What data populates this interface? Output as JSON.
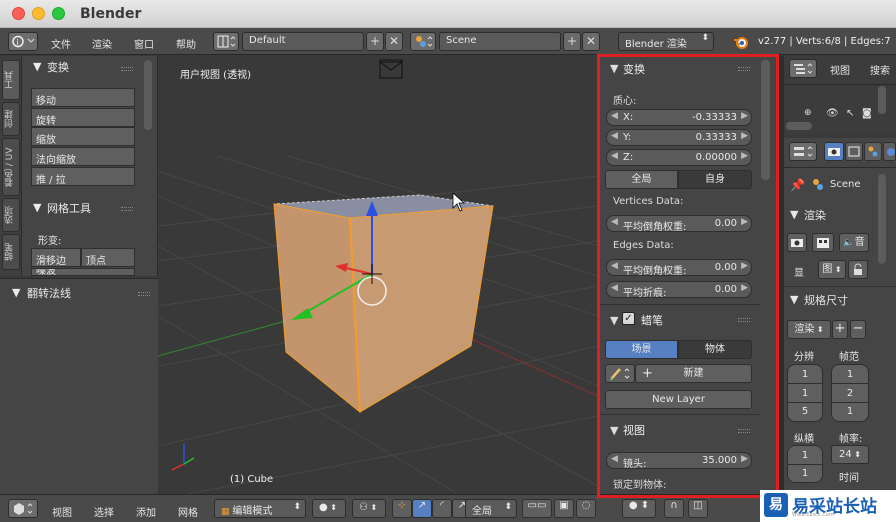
{
  "window": {
    "title": "Blender"
  },
  "info_header": {
    "menus": [
      "文件",
      "渲染",
      "窗口",
      "帮助"
    ],
    "layout_name": "Default",
    "scene_name": "Scene",
    "render_engine": "Blender 渲染",
    "stats": "v2.77 | Verts:6/8 | Edges:7"
  },
  "tool_tabs": [
    "工具",
    "创建",
    "着色 / UV",
    "选项",
    "蜡笔"
  ],
  "tool_shelf": {
    "transform_title": "变换",
    "transform_buttons": [
      "移动",
      "旋转",
      "缩放",
      "法向缩放",
      "推 / 拉"
    ],
    "mesh_tools_title": "网格工具",
    "deform_label": "形变:",
    "deform_buttons": [
      "滑移边",
      "顶点"
    ],
    "deform_partial": "噪波"
  },
  "operator_panel": {
    "title": "翻转法线"
  },
  "viewport": {
    "view_label": "用户视图 (透视)",
    "object_label": "(1) Cube"
  },
  "properties_panel": {
    "transform_title": "变换",
    "median_label": "质心:",
    "x": {
      "label": "X:",
      "value": "-0.33333"
    },
    "y": {
      "label": "Y:",
      "value": "0.33333"
    },
    "z": {
      "label": "Z:",
      "value": "0.00000"
    },
    "space_global": "全局",
    "space_local": "自身",
    "vertices_data_label": "Vertices Data:",
    "vertex_bevel": {
      "label": "平均倒角权重:",
      "value": "0.00"
    },
    "edges_data_label": "Edges Data:",
    "edge_bevel": {
      "label": "平均倒角权重:",
      "value": "0.00"
    },
    "edge_crease": {
      "label": "平均折痕:",
      "value": "0.00"
    },
    "grease_title": "蜡笔",
    "grease_scene": "场景",
    "grease_object": "物体",
    "grease_new": "新建",
    "new_layer": "New Layer",
    "view_title": "视图",
    "lens": {
      "label": "镜头:",
      "value": "35.000"
    },
    "lock_to_object": "锁定到物体:"
  },
  "outliner": {
    "view_menu": "视图",
    "search_menu": "搜索"
  },
  "render_props": {
    "scene_label": "Scene",
    "render_title": "渲染",
    "render_btn_1": "渲染",
    "render_btn_2": "动画",
    "audio_label": "音",
    "display_label": "显",
    "display_value": "图",
    "dimensions_title": "规格尺寸",
    "preset_label": "渲染",
    "resolution_label": "分辨",
    "frame_range_label": "帧范",
    "res_values": [
      "1",
      "1",
      "5"
    ],
    "frame_values": [
      "1",
      "2",
      "1"
    ],
    "aspect_label": "纵横",
    "frame_rate_label": "帧率:",
    "aspect_values": [
      "1",
      "1"
    ],
    "frame_rate_value": "24",
    "time_label": "时间"
  },
  "bottom_header": {
    "menus": [
      "视图",
      "选择",
      "添加",
      "网格"
    ],
    "mode": "编辑模式",
    "pivot": "全局"
  },
  "watermark": {
    "logo": "易",
    "text": "易采站长站",
    "sub": "Www.Easck.Com"
  },
  "colors": {
    "selection_orange": "#f39c28",
    "frame_red": "#e02020",
    "active_blue": "#5680c2"
  }
}
